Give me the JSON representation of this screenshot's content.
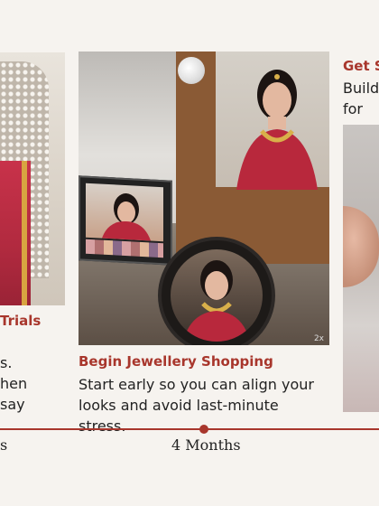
{
  "cards": {
    "left": {
      "title_fragment": "Trials",
      "line1": "s.",
      "line2": "hen  say"
    },
    "center": {
      "title": "Begin Jewellery Shopping",
      "line1": "Start early so you can align your",
      "line2": "looks and avoid last-minute stress.",
      "watermark": "2x"
    },
    "right": {
      "title_fragment": "Get S",
      "line1": "Build",
      "line2": "for yo"
    }
  },
  "timeline": {
    "center_label": "4 Months",
    "left_label": "s"
  },
  "colors": {
    "accent": "#a8362c",
    "background": "#f6f3ef",
    "text": "#222222"
  }
}
